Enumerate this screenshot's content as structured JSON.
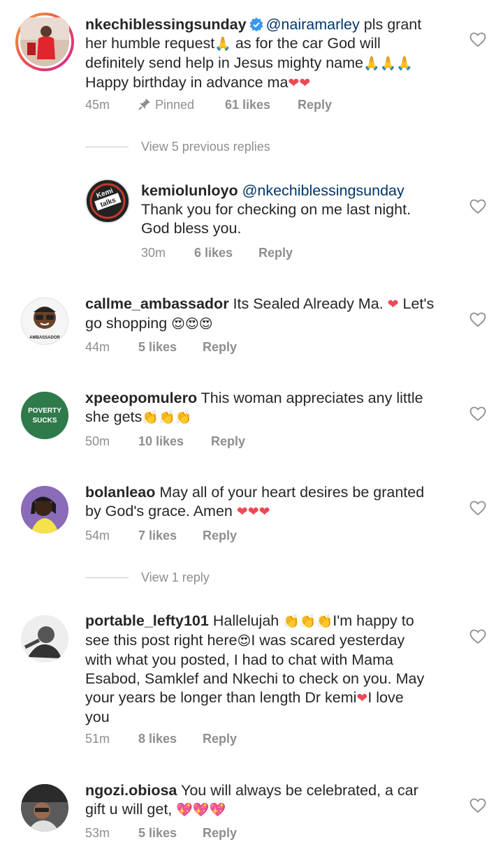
{
  "comments": [
    {
      "username": "nkechiblessingsunday",
      "mention": "@nairamarley",
      "text1": " pls grant",
      "line2": "her humble request",
      "line2b": " as for the car God will",
      "line3": "definitely send help in Jesus mighty name",
      "line4": "Happy birthday in advance ma",
      "time": "45m",
      "pinned": "Pinned",
      "likes": "61 likes",
      "reply": "Reply",
      "view_replies": "View 5 previous replies"
    },
    {
      "username": "kemiolunloyo",
      "mention": "@nkechiblessingsunday",
      "line2": "Thank you for checking on me last night.",
      "line3": "God bless you.",
      "time": "30m",
      "likes": "6 likes",
      "reply": "Reply",
      "avatar_text": "Kemi talks"
    },
    {
      "username": "callme_ambassador",
      "text1": " Its Sealed Already Ma. ",
      "text1b": " Let's",
      "line2": "go shopping ",
      "time": "44m",
      "likes": "5 likes",
      "reply": "Reply",
      "avatar_text": "AMBASSADOR"
    },
    {
      "username": "xpeeopomulero",
      "text1": " This woman appreciates any little",
      "line2": "she gets",
      "time": "50m",
      "likes": "10 likes",
      "reply": "Reply",
      "avatar_text1": "POVERTY",
      "avatar_text2": "SUCKS"
    },
    {
      "username": "bolanleao",
      "text1": " May all of your heart desires be granted",
      "line2": "by God's grace. Amen ",
      "time": "54m",
      "likes": "7 likes",
      "reply": "Reply",
      "view_replies": "View 1 reply"
    },
    {
      "username": "portable_lefty101",
      "text1": " Hallelujah ",
      "text1b": "I'm happy to",
      "line2": "see this post right here",
      "line2b": "I was scared yesterday",
      "line3": "with what you posted, I had to chat with Mama",
      "line4": "Esabod, Samklef and Nkechi to check on you. May",
      "line5": "your years be longer than length Dr kemi",
      "line5b": "I love",
      "line6": "you",
      "time": "51m",
      "likes": "8 likes",
      "reply": "Reply"
    },
    {
      "username": "ngozi.obiosa",
      "text1": " You will always be celebrated, a car",
      "line2": "gift u will get, ",
      "time": "53m",
      "likes": "5 likes",
      "reply": "Reply"
    }
  ],
  "colors": {
    "text": "#262626",
    "meta": "#8e8e8e",
    "mention": "#00376b",
    "verified": "#3897f0",
    "heart_red": "#ed4956"
  }
}
